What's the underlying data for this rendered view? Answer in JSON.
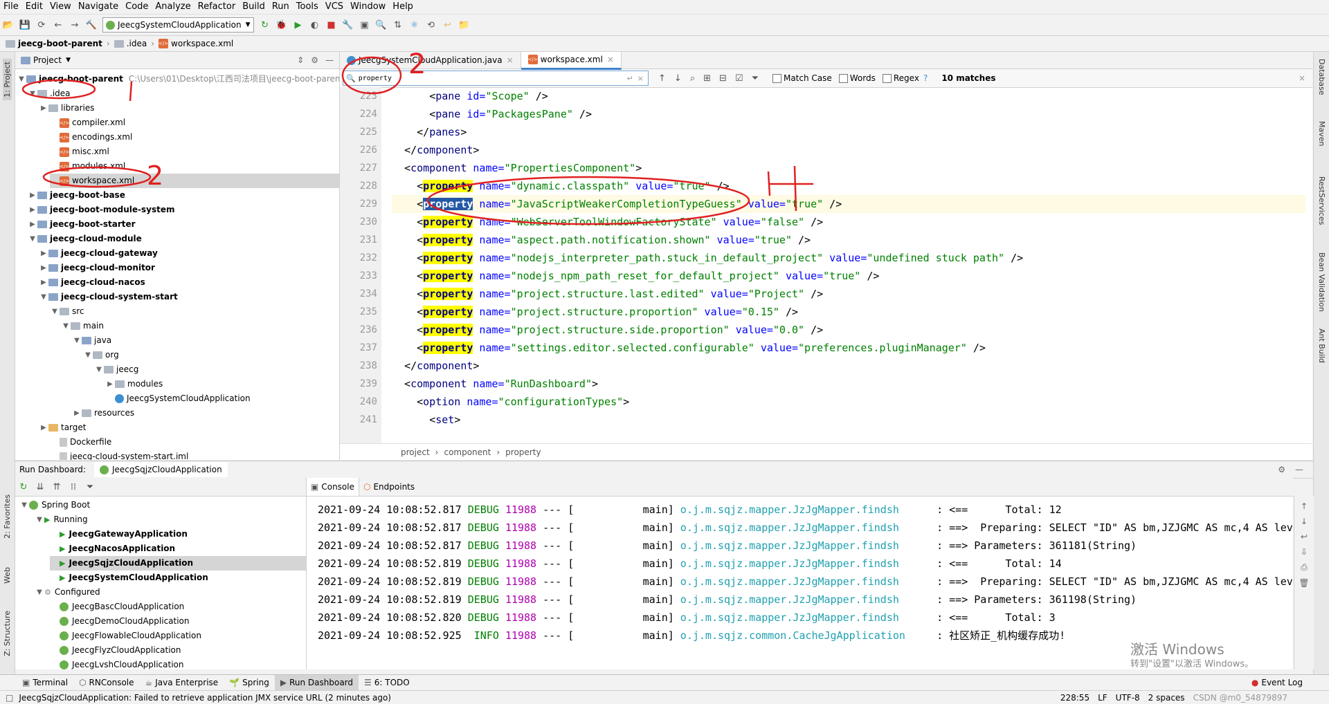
{
  "menu": [
    "File",
    "Edit",
    "View",
    "Navigate",
    "Code",
    "Analyze",
    "Refactor",
    "Build",
    "Run",
    "Tools",
    "VCS",
    "Window",
    "Help"
  ],
  "toolbar": {
    "run_config": "JeecgSystemCloudApplication"
  },
  "nav": {
    "crumbs": [
      "jeecg-boot-parent",
      ".idea",
      "workspace.xml"
    ]
  },
  "project": {
    "title": "Project",
    "root_name": "jeecg-boot-parent",
    "root_path": "C:\\Users\\01\\Desktop\\江西司法项目\\jeecg-boot-parent",
    "tree": [
      {
        "label": ".idea"
      },
      {
        "label": "libraries"
      },
      {
        "label": "compiler.xml"
      },
      {
        "label": "encodings.xml"
      },
      {
        "label": "misc.xml"
      },
      {
        "label": "modules.xml"
      },
      {
        "label": "workspace.xml"
      },
      {
        "label": "jeecg-boot-base"
      },
      {
        "label": "jeecg-boot-module-system"
      },
      {
        "label": "jeecg-boot-starter"
      },
      {
        "label": "jeecg-cloud-module"
      },
      {
        "label": "jeecg-cloud-gateway"
      },
      {
        "label": "jeecg-cloud-monitor"
      },
      {
        "label": "jeecg-cloud-nacos"
      },
      {
        "label": "jeecg-cloud-system-start"
      },
      {
        "label": "src"
      },
      {
        "label": "main"
      },
      {
        "label": "java"
      },
      {
        "label": "org"
      },
      {
        "label": "jeecg"
      },
      {
        "label": "modules"
      },
      {
        "label": "JeecgSystemCloudApplication"
      },
      {
        "label": "resources"
      },
      {
        "label": "target"
      },
      {
        "label": "Dockerfile"
      },
      {
        "label": "jeecg-cloud-system-start.iml"
      }
    ]
  },
  "editor": {
    "tabs": [
      "JeecgSystemCloudApplication.java",
      "workspace.xml"
    ],
    "search": "property",
    "find_options": [
      "Match Case",
      "Words",
      "Regex"
    ],
    "matches": "10 matches",
    "line_numbers": [
      "223",
      "224",
      "225",
      "226",
      "227",
      "228",
      "229",
      "230",
      "231",
      "232",
      "233",
      "234",
      "235",
      "236",
      "237",
      "238",
      "239",
      "240",
      "241"
    ],
    "lines": [
      {
        "indent": "      ",
        "open": "<",
        "tag": "pane",
        "attr": " id=",
        "val": "\"Scope\"",
        "close": " />"
      },
      {
        "indent": "      ",
        "open": "<",
        "tag": "pane",
        "attr": " id=",
        "val": "\"PackagesPane\"",
        "close": " />"
      },
      {
        "indent": "    ",
        "open": "</",
        "tag": "panes",
        "attr": "",
        "val": "",
        "close": ">"
      },
      {
        "indent": "  ",
        "open": "</",
        "tag": "component",
        "attr": "",
        "val": "",
        "close": ">"
      },
      {
        "indent": "  ",
        "open": "<",
        "tag": "component",
        "attr": " name=",
        "val": "\"PropertiesComponent\"",
        "close": ">"
      },
      {
        "prop": "property",
        "name": "\"dynamic.classpath\"",
        "vattr": " value=",
        "value": "\"true\""
      },
      {
        "prop": "property",
        "name": "\"JavaScriptWeakerCompletionTypeGuess\"",
        "vattr": " value=",
        "value": "\"true\""
      },
      {
        "prop": "property",
        "name": "\"WebServerToolWindowFactoryState\"",
        "vattr": " value=",
        "value": "\"false\""
      },
      {
        "prop": "property",
        "name": "\"aspect.path.notification.shown\"",
        "vattr": " value=",
        "value": "\"true\""
      },
      {
        "prop": "property",
        "name": "\"nodejs_interpreter_path.stuck_in_default_project\"",
        "vattr": " value=",
        "value": "\"undefined stuck path\""
      },
      {
        "prop": "property",
        "name": "\"nodejs_npm_path_reset_for_default_project\"",
        "vattr": " value=",
        "value": "\"true\""
      },
      {
        "prop": "property",
        "name": "\"project.structure.last.edited\"",
        "vattr": " value=",
        "value": "\"Project\""
      },
      {
        "prop": "property",
        "name": "\"project.structure.proportion\"",
        "vattr": " value=",
        "value": "\"0.15\""
      },
      {
        "prop": "property",
        "name": "\"project.structure.side.proportion\"",
        "vattr": " value=",
        "value": "\"0.0\""
      },
      {
        "prop": "property",
        "name": "\"settings.editor.selected.configurable\"",
        "vattr": " value=",
        "value": "\"preferences.pluginManager\""
      },
      {
        "indent": "  ",
        "open": "</",
        "tag": "component",
        "attr": "",
        "val": "",
        "close": ">"
      },
      {
        "indent": "  ",
        "open": "<",
        "tag": "component",
        "attr": " name=",
        "val": "\"RunDashboard\"",
        "close": ">"
      },
      {
        "indent": "    ",
        "open": "<",
        "tag": "option",
        "attr": " name=",
        "val": "\"configurationTypes\"",
        "close": ">"
      },
      {
        "indent": "      ",
        "open": "<",
        "tag": "set",
        "attr": "",
        "val": "",
        "close": ">"
      }
    ],
    "name_attr": " name=",
    "breadcrumb": [
      "project",
      "component",
      "property"
    ]
  },
  "run": {
    "title": "Run Dashboard:",
    "tab": "JeecgSqjzCloudApplication",
    "tree": [
      {
        "label": "Spring Boot"
      },
      {
        "label": "Running"
      },
      {
        "label": "JeecgGatewayApplication"
      },
      {
        "label": "JeecgNacosApplication"
      },
      {
        "label": "JeecgSqjzCloudApplication"
      },
      {
        "label": "JeecgSystemCloudApplication"
      },
      {
        "label": "Configured"
      },
      {
        "label": "JeecgBascCloudApplication"
      },
      {
        "label": "JeecgDemoCloudApplication"
      },
      {
        "label": "JeecgFlowableCloudApplication"
      },
      {
        "label": "JeecgFlyzCloudApplication"
      },
      {
        "label": "JeecgLvshCloudApplication"
      }
    ],
    "console_tabs": [
      "Console",
      "Endpoints"
    ],
    "log": [
      {
        "ts": "2021-09-24 10:08:52.817",
        "lvl": "DEBUG",
        "pid": "11988",
        "sep": " --- [",
        "thread": "           main]",
        "logger": " o.j.m.sqjz.mapper.JzJgMapper.findsh     ",
        "msg": " : <==      Total: 12"
      },
      {
        "ts": "2021-09-24 10:08:52.817",
        "lvl": "DEBUG",
        "pid": "11988",
        "sep": " --- [",
        "thread": "           main]",
        "logger": " o.j.m.sqjz.mapper.JzJgMapper.findsh     ",
        "msg": " : ==>  Preparing: SELECT \"ID\" AS bm,JZJGMC AS mc,4 AS leve"
      },
      {
        "ts": "2021-09-24 10:08:52.817",
        "lvl": "DEBUG",
        "pid": "11988",
        "sep": " --- [",
        "thread": "           main]",
        "logger": " o.j.m.sqjz.mapper.JzJgMapper.findsh     ",
        "msg": " : ==> Parameters: 361181(String)"
      },
      {
        "ts": "2021-09-24 10:08:52.819",
        "lvl": "DEBUG",
        "pid": "11988",
        "sep": " --- [",
        "thread": "           main]",
        "logger": " o.j.m.sqjz.mapper.JzJgMapper.findsh     ",
        "msg": " : <==      Total: 14"
      },
      {
        "ts": "2021-09-24 10:08:52.819",
        "lvl": "DEBUG",
        "pid": "11988",
        "sep": " --- [",
        "thread": "           main]",
        "logger": " o.j.m.sqjz.mapper.JzJgMapper.findsh     ",
        "msg": " : ==>  Preparing: SELECT \"ID\" AS bm,JZJGMC AS mc,4 AS leve"
      },
      {
        "ts": "2021-09-24 10:08:52.819",
        "lvl": "DEBUG",
        "pid": "11988",
        "sep": " --- [",
        "thread": "           main]",
        "logger": " o.j.m.sqjz.mapper.JzJgMapper.findsh     ",
        "msg": " : ==> Parameters: 361198(String)"
      },
      {
        "ts": "2021-09-24 10:08:52.820",
        "lvl": "DEBUG",
        "pid": "11988",
        "sep": " --- [",
        "thread": "           main]",
        "logger": " o.j.m.sqjz.mapper.JzJgMapper.findsh     ",
        "msg": " : <==      Total: 3"
      },
      {
        "ts": "2021-09-24 10:08:52.925",
        "lvl": " INFO",
        "pid": "11988",
        "sep": " --- [",
        "thread": "           main]",
        "logger": " o.j.m.sqjz.common.CacheJgApplication    ",
        "msg": " : 社区矫正_机构缓存成功!"
      }
    ]
  },
  "tool_tabs": [
    "Terminal",
    "RNConsole",
    "Java Enterprise",
    "Spring",
    "Run Dashboard",
    "6: TODO"
  ],
  "event_log": "Event Log",
  "status": {
    "message": "JeecgSqjzCloudApplication: Failed to retrieve application JMX service URL (2 minutes ago)",
    "position": "228:55",
    "line_sep": "LF",
    "encoding": "UTF-8",
    "indent": "2 spaces"
  },
  "watermark": {
    "line1": "激活 Windows",
    "line2": "转到\"设置\"以激活 Windows。",
    "csdn": "CSDN @m0_54879897"
  },
  "left_stripe": [
    "1: Project",
    "2: Favorites",
    "Web",
    "Z: Structure"
  ],
  "right_stripe": [
    "Database",
    "Maven",
    "RestServices",
    "Bean Validation",
    "Ant Build"
  ],
  "annotations": {
    "n2": "2",
    "n4": "4"
  }
}
